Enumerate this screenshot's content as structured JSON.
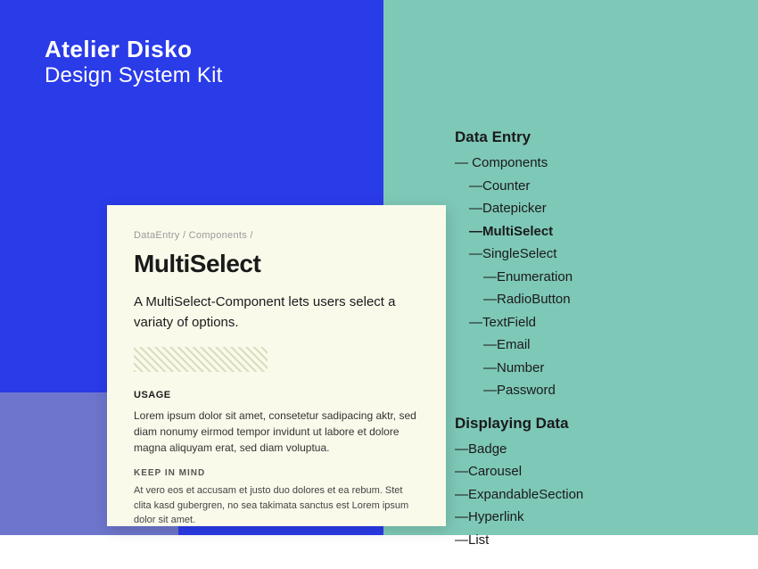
{
  "header": {
    "title": "Atelier Disko",
    "subtitle": "Design System Kit"
  },
  "nav": {
    "sections": [
      {
        "id": "data-entry",
        "title": "Data Entry",
        "items": [
          {
            "label": "— Components",
            "indent": 0
          },
          {
            "label": "—Counter",
            "indent": 1
          },
          {
            "label": "—Datepicker",
            "indent": 1
          },
          {
            "label": "—MultiSelect",
            "indent": 1,
            "highlight": true
          },
          {
            "label": "—SingleSelect",
            "indent": 1
          },
          {
            "label": "—Enumeration",
            "indent": 2
          },
          {
            "label": "—RadioButton",
            "indent": 2
          },
          {
            "label": "—TextField",
            "indent": 1
          },
          {
            "label": "—Email",
            "indent": 2
          },
          {
            "label": "—Number",
            "indent": 2
          },
          {
            "label": "—Password",
            "indent": 2
          }
        ]
      },
      {
        "id": "displaying-data",
        "title": "Displaying Data",
        "items": [
          {
            "label": "—Badge",
            "indent": 0
          },
          {
            "label": "—Carousel",
            "indent": 0
          },
          {
            "label": "—ExpandableSection",
            "indent": 0
          },
          {
            "label": "—Hyperlink",
            "indent": 0
          },
          {
            "label": "—List",
            "indent": 0
          }
        ]
      }
    ]
  },
  "document": {
    "breadcrumb": "DataEntry / Components /",
    "title": "MultiSelect",
    "description": "A MultiSelect-Component lets users select a variaty of options.",
    "usage_label": "Usage",
    "usage_text": "Lorem ipsum dolor sit amet, consetetur sadipacing aktr, sed diam nonumy eirmod tempor invidunt ut labore et dolore magna aliquyam erat, sed diam voluptua.",
    "keep_in_mind_label": "KEEP IN MIND",
    "keep_in_mind_text": "At vero eos et accusam et justo duo dolores et ea rebum. Stet clita kasd gubergren, no sea takimata sanctus est Lorem ipsum dolor sit amet."
  }
}
